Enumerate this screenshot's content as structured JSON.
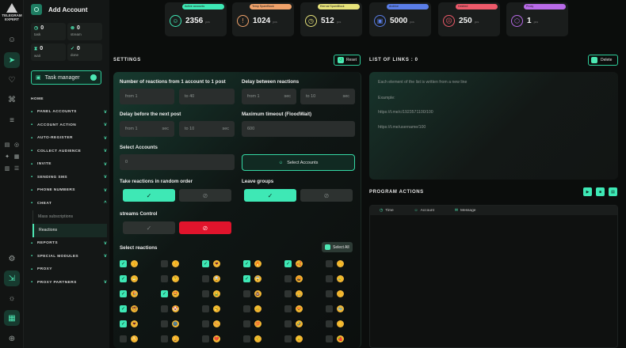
{
  "app": {
    "logo_line1": "TELEGRAM",
    "logo_line2": "EXPERT",
    "page_title": "Add Account"
  },
  "side_stats": [
    {
      "value": "0",
      "label": "task"
    },
    {
      "value": "0",
      "label": "stream"
    },
    {
      "value": "0",
      "label": "wait"
    },
    {
      "value": "0",
      "label": "done"
    }
  ],
  "task_manager": {
    "label": "Task manager"
  },
  "menu": {
    "home": "HOME",
    "items": [
      {
        "label": "PANEL ACCOUNTS",
        "chevron": "v"
      },
      {
        "label": "ACCOUNT ACTION",
        "chevron": "v"
      },
      {
        "label": "AUTO-REGISTER",
        "chevron": "v"
      },
      {
        "label": "COLLECT AUDIENCE",
        "chevron": "v"
      },
      {
        "label": "INVITE",
        "chevron": "v"
      },
      {
        "label": "SENDING SMS",
        "chevron": "v"
      },
      {
        "label": "PHONE NUMBERS",
        "chevron": "v"
      },
      {
        "label": "CHEAT",
        "chevron": "^"
      }
    ],
    "subitems": [
      "Mass subscriptions",
      "Reactions"
    ],
    "items_after": [
      {
        "label": "REPORTS",
        "chevron": "v"
      },
      {
        "label": "SPECIAL MODULES",
        "chevron": "v"
      },
      {
        "label": "PROXY",
        "chevron": ""
      },
      {
        "label": "PROXY PARTNERS",
        "chevron": "v"
      }
    ]
  },
  "cards": [
    {
      "badge": "Active accounts",
      "value": "2356",
      "unit": "pcs",
      "color": "#3ee8b5",
      "icon_color": "#3ee8b5",
      "icon": "user-icon"
    },
    {
      "badge": "Temp SpamBlock",
      "value": "1024",
      "unit": "pcs",
      "color": "#f0a26a",
      "icon_color": "#f0a26a",
      "icon": "alert-icon"
    },
    {
      "badge": "Eternal SpamBlock",
      "value": "512",
      "unit": "pcs",
      "color": "#e7e37a",
      "icon_color": "#e7e37a",
      "icon": "clock-icon"
    },
    {
      "badge": "Archive",
      "value": "5000",
      "unit": "pcs",
      "color": "#5a7ee8",
      "icon_color": "#5a7ee8",
      "icon": "archive-icon"
    },
    {
      "badge": "Deleted",
      "value": "250",
      "unit": "pcs",
      "color": "#ee5a6a",
      "icon_color": "#ee5a6a",
      "icon": "user-x-icon"
    },
    {
      "badge": "Proxy",
      "value": "1",
      "unit": "pcs",
      "color": "#b86ae8",
      "icon_color": "#b86ae8",
      "icon": "proxy-icon"
    }
  ],
  "settings": {
    "title": "SETTINGS",
    "reset_label": "Reset",
    "reactions_label": "Number of reactions from 1 account to 1 post",
    "reactions_from": "from 1",
    "reactions_to": "to 40",
    "delay_reactions_label": "Delay between reactions",
    "delay_reactions_from": "from 1",
    "delay_reactions_to": "to 10",
    "sec": "sec",
    "delay_post_label": "Delay before the next post",
    "delay_post_from": "from 1",
    "delay_post_to": "to 10",
    "max_timeout_label": "Maximum timeout (FloodWait)",
    "max_timeout_value": "600",
    "select_accounts_label": "Select Accounts",
    "select_accounts_value": "0",
    "select_accounts_button": "Select Accounts",
    "random_order_label": "Take reactions in random order",
    "leave_groups_label": "Leave groups",
    "streams_label": "streams Control",
    "select_reactions_label": "Select reactions",
    "select_all_label": "Select All"
  },
  "links": {
    "title": "LIST OF LINKS : 0",
    "delete_label": "Delete",
    "hint": "Each element of the list is written from a new line",
    "example": "Example:",
    "example1": "https://t.me/c/1923571100/100",
    "example2": "https://t.me/username/100"
  },
  "program_actions": {
    "title": "PROGRAM ACTIONS",
    "col_time": "Time",
    "col_account": "Account",
    "col_message": "Message"
  },
  "reactions_grid": {
    "rows": [
      [
        {
          "c": true,
          "e": "👍"
        },
        {
          "c": false,
          "e": "👎"
        },
        {
          "c": true,
          "e": "❤"
        },
        {
          "c": true,
          "e": "🔥"
        },
        {
          "c": true,
          "e": "🥰"
        },
        {
          "c": false,
          "e": "👏"
        }
      ],
      [
        {
          "c": true,
          "e": "😁"
        },
        {
          "c": false,
          "e": "🤔"
        },
        {
          "c": false,
          "e": "🤯"
        },
        {
          "c": true,
          "e": "😱"
        },
        {
          "c": false,
          "e": "🤬"
        },
        {
          "c": false,
          "e": "😢"
        }
      ],
      [
        {
          "c": true,
          "e": "🎉"
        },
        {
          "c": true,
          "e": "🤩"
        },
        {
          "c": false,
          "e": "🤮"
        },
        {
          "c": false,
          "e": "💩"
        },
        {
          "c": false,
          "e": "🙏"
        },
        {
          "c": false,
          "e": "👌"
        }
      ],
      [
        {
          "c": true,
          "e": "🕊"
        },
        {
          "c": false,
          "e": "🤡"
        },
        {
          "c": false,
          "e": "🥱"
        },
        {
          "c": false,
          "e": "🥴"
        },
        {
          "c": false,
          "e": "😍"
        },
        {
          "c": false,
          "e": "🐳"
        }
      ],
      [
        {
          "c": true,
          "e": "❤"
        },
        {
          "c": false,
          "e": "🌚"
        },
        {
          "c": false,
          "e": "🌭"
        },
        {
          "c": false,
          "e": "💯"
        },
        {
          "c": false,
          "e": "🤣"
        },
        {
          "c": false,
          "e": "⚡"
        }
      ],
      [
        {
          "c": false,
          "e": "🍌"
        },
        {
          "c": false,
          "e": "🏆"
        },
        {
          "c": false,
          "e": "💔"
        },
        {
          "c": false,
          "e": "🤨"
        },
        {
          "c": false,
          "e": "😐"
        },
        {
          "c": false,
          "e": "🍓"
        }
      ]
    ]
  }
}
